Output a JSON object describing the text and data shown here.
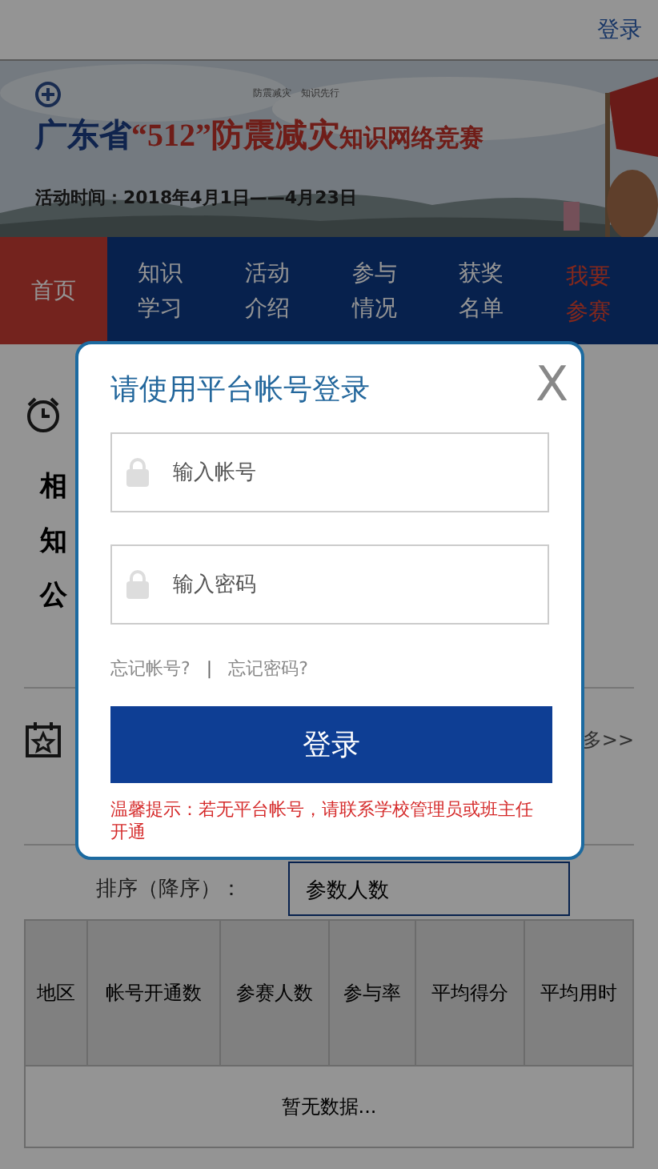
{
  "header": {
    "login_link": "登录"
  },
  "banner": {
    "kind": "picture",
    "slogan": "防震减灾　知识先行",
    "title_parts": [
      {
        "kind": "lead",
        "text": "广东省"
      },
      {
        "kind": "accent",
        "text": "“512”"
      },
      {
        "kind": "accent",
        "text": "防震减灾"
      },
      {
        "kind": "tail",
        "text": "知识网络竞赛"
      }
    ],
    "date": "活动时间：2018年4月1日——4月23日"
  },
  "nav": [
    {
      "label": "首页",
      "selected": true,
      "kind": "normal"
    },
    {
      "label": "知识学习",
      "selected": false,
      "kind": "normal"
    },
    {
      "label": "活动介绍",
      "selected": false,
      "kind": "normal"
    },
    {
      "label": "参与情况",
      "selected": false,
      "kind": "normal"
    },
    {
      "label": "获奖名单",
      "selected": false,
      "kind": "normal"
    },
    {
      "label": "我要参赛",
      "selected": false,
      "kind": "cta"
    }
  ],
  "sections": [
    {
      "kind": "clock",
      "lines": [
        "相",
        "知",
        "公"
      ]
    },
    {
      "kind": "star",
      "more": "多>>"
    }
  ],
  "sort": {
    "label": "排序（降序）：",
    "value": "参数人数"
  },
  "table": {
    "columns": [
      "地区",
      "帐号开通数",
      "参赛人数",
      "参与率",
      "平均得分",
      "平均用时"
    ],
    "empty_text": "暂无数据..."
  },
  "modal": {
    "title": "请使用平台帐号登录",
    "close": "X",
    "fields": [
      {
        "placeholder": "输入帐号"
      },
      {
        "placeholder": "输入密码"
      }
    ],
    "links": [
      "忘记帐号?",
      "忘记密码?"
    ],
    "separator": "|",
    "button": "登录",
    "hint": "温馨提示：若无平台帐号，请联系学校管理员或班主任开通"
  }
}
